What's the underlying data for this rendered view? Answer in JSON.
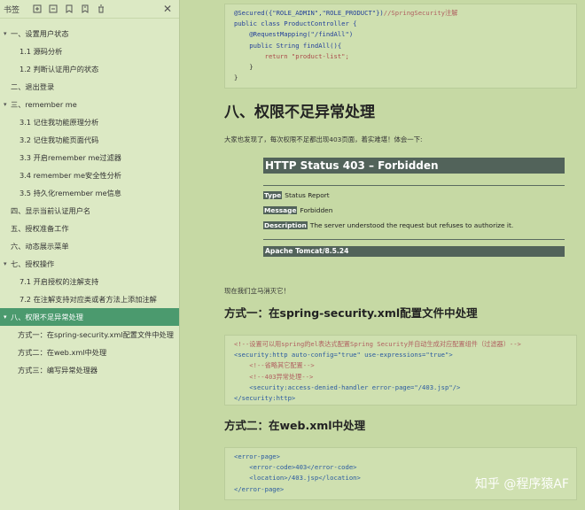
{
  "sidebar": {
    "toolbar_title": "书签",
    "icons": [
      "expand-all-icon",
      "collapse-all-icon",
      "bookmark-add-icon",
      "bookmark-icon",
      "delete-icon"
    ],
    "close": "✕",
    "items": [
      {
        "label": "一、设置用户状态",
        "level": 0,
        "arrow": "▾"
      },
      {
        "label": "1.1 源码分析",
        "level": 1
      },
      {
        "label": "1.2 判断认证用户的状态",
        "level": 1
      },
      {
        "label": "二、退出登录",
        "level": 0,
        "arrow": ""
      },
      {
        "label": "三、remember me",
        "level": 0,
        "arrow": "▾"
      },
      {
        "label": "3.1 记住我功能原理分析",
        "level": 1
      },
      {
        "label": "3.2 记住我功能页面代码",
        "level": 1
      },
      {
        "label": "3.3 开启remember me过滤器",
        "level": 1
      },
      {
        "label": "3.4 remember me安全性分析",
        "level": 1
      },
      {
        "label": "3.5 持久化remember me信息",
        "level": 1
      },
      {
        "label": "四、显示当前认证用户名",
        "level": 0,
        "arrow": ""
      },
      {
        "label": "五、授权准备工作",
        "level": 0,
        "arrow": ""
      },
      {
        "label": "六、动态展示菜单",
        "level": 0,
        "arrow": ""
      },
      {
        "label": "七、授权操作",
        "level": 0,
        "arrow": "▾"
      },
      {
        "label": "7.1 开启授权的注解支持",
        "level": 1
      },
      {
        "label": "7.2 在注解支持对应类或者方法上添加注解",
        "level": 1
      },
      {
        "label": "八、权限不足异常处理",
        "level": 0,
        "arrow": "▾",
        "active": true
      },
      {
        "label": "方式一：在spring-security.xml配置文件中处理",
        "level": 2
      },
      {
        "label": "方式二：在web.xml中处理",
        "level": 2
      },
      {
        "label": "方式三：编写异常处理器",
        "level": 2
      }
    ]
  },
  "content": {
    "code1": {
      "line1_anno": "@Secured({\"ROLE_ADMIN\",\"ROLE_PRODUCT\"})",
      "line1_comment": "//SpringSecurity注解",
      "line2": "public class ProductController {",
      "line3": "    @RequestMapping(\"/findAll\")",
      "line4": "    public String findAll(){",
      "line5": "        return \"product-list\";",
      "line6": "    }",
      "line7": "}"
    },
    "heading_sec8": "八、权限不足异常处理",
    "intro": "大家也发现了，每次权限不足都出现403页面，着实难堪！体会一下:",
    "error_page": {
      "title": "HTTP Status 403 – Forbidden",
      "type_label": "Type",
      "type_value": "Status Report",
      "message_label": "Message",
      "message_value": "Forbidden",
      "description_label": "Description",
      "description_value": "The server understood the request but refuses to authorize it.",
      "footer": "Apache Tomcat/8.5.24"
    },
    "fix_text": "现在我们立马消灭它！",
    "heading_m1": "方式一：在spring-security.xml配置文件中处理",
    "code2": {
      "line1": "<!--设置可以用spring的el表达式配置Spring Security并自动生成对应配置组件（过滤器）-->",
      "line2": "<security:http auto-config=\"true\" use-expressions=\"true\">",
      "line3": "    <!--省略其它配置-->",
      "line4": "    <!--403异常处理-->",
      "line5": "    <security:access-denied-handler error-page=\"/403.jsp\"/>",
      "line6": "</security:http>"
    },
    "heading_m2": "方式二：在web.xml中处理",
    "code3": {
      "line1": "<error-page>",
      "line2": "    <error-code>403</error-code>",
      "line3": "    <location>/403.jsp</location>",
      "line4": "</error-page>"
    }
  },
  "watermark": "知乎 @程序猿AF"
}
